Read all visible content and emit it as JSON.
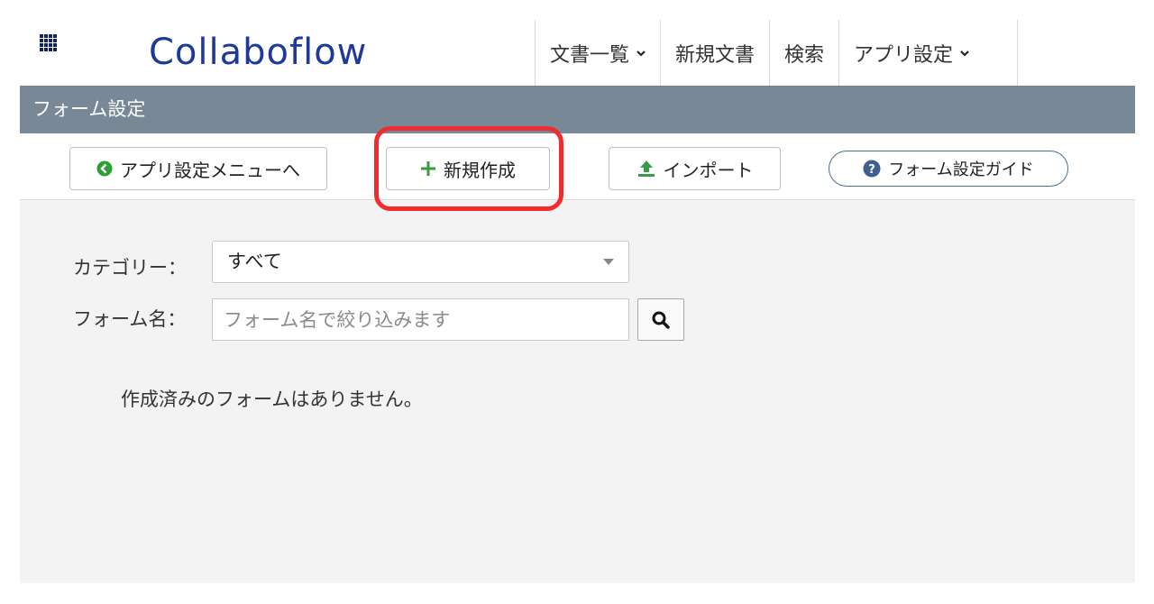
{
  "header": {
    "logo_text": "Collaboflow",
    "nav": [
      {
        "label": "文書一覧",
        "has_dropdown": true
      },
      {
        "label": "新規文書",
        "has_dropdown": false
      },
      {
        "label": "検索",
        "has_dropdown": false
      },
      {
        "label": "アプリ設定",
        "has_dropdown": true
      }
    ]
  },
  "section": {
    "title": "フォーム設定"
  },
  "toolbar": {
    "back_label": "アプリ設定メニューへ",
    "new_label": "新規作成",
    "import_label": "インポート",
    "guide_label": "フォーム設定ガイド"
  },
  "filters": {
    "category_label": "カテゴリー：",
    "category_value": "すべて",
    "name_label": "フォーム名：",
    "name_placeholder": "フォーム名で絞り込みます"
  },
  "message": {
    "empty": "作成済みのフォームはありません。"
  },
  "colors": {
    "section_bar": "#788897",
    "logo": "#1c3a9b",
    "highlight": "#f22c2c",
    "back_icon": "#2f9e34",
    "plus_icon": "#3b9a3b",
    "import_icon": "#3a9a4a",
    "guide_icon": "#3f5f8e"
  }
}
